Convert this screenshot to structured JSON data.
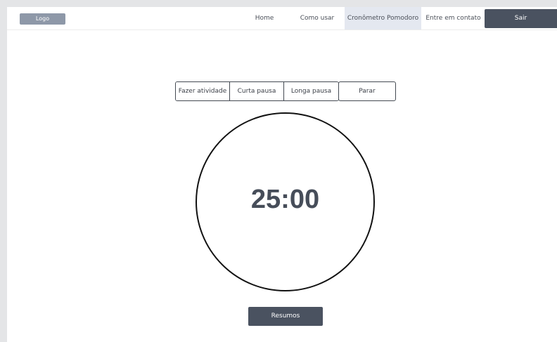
{
  "navbar": {
    "logo_label": "Logo",
    "links": [
      {
        "label": "Home"
      },
      {
        "label": "Como usar"
      },
      {
        "label": "Cronômetro Pomodoro",
        "active": true
      },
      {
        "label": "Entre em contato"
      }
    ],
    "logout_label": "Sair"
  },
  "timer": {
    "modes": [
      "Fazer atividade",
      "Curta pausa",
      "Longa pausa"
    ],
    "stop_label": "Parar",
    "display": "25:00"
  },
  "summary_label": "Resumos",
  "colors": {
    "dark_button": "#4a5260",
    "active_tab_bg": "#e4e8f0",
    "logo_bg": "#8e98a8",
    "timer_text": "#464d59"
  }
}
